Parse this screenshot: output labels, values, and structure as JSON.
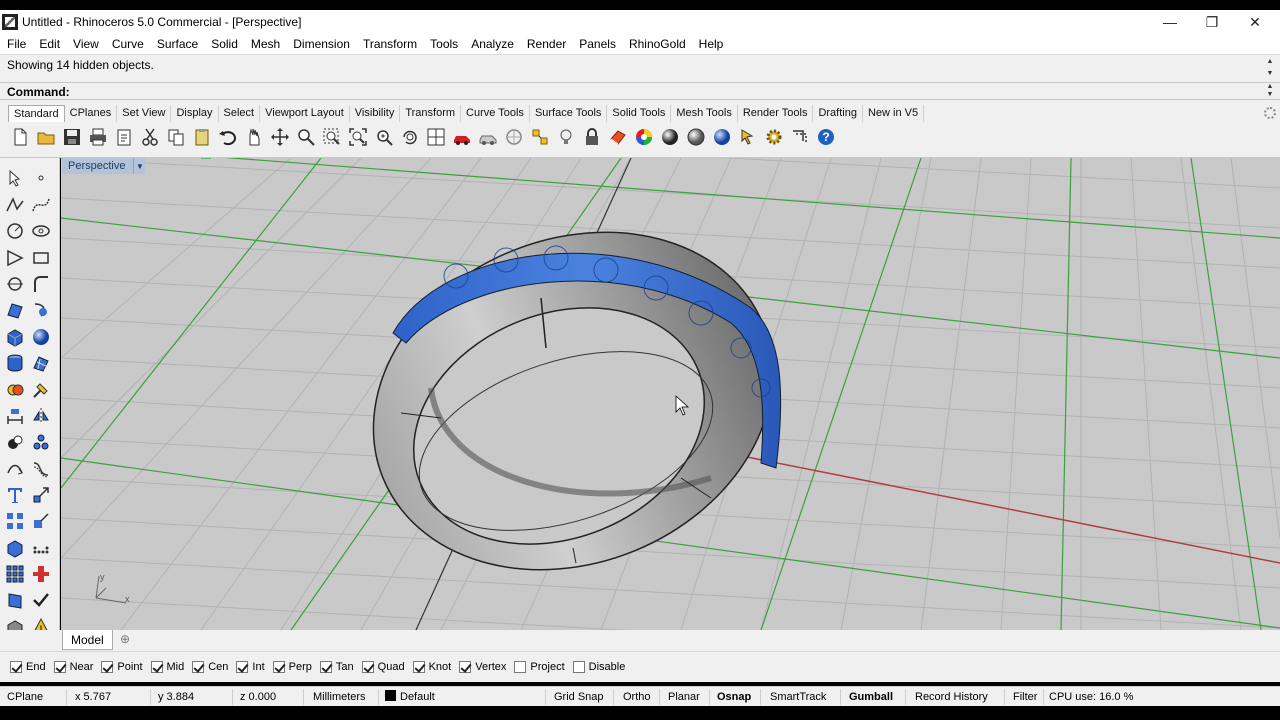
{
  "window": {
    "title": "Untitled - Rhinoceros 5.0 Commercial - [Perspective]",
    "controls": {
      "minimize": "—",
      "restore": "❐",
      "close": "✕"
    }
  },
  "menu": [
    "File",
    "Edit",
    "View",
    "Curve",
    "Surface",
    "Solid",
    "Mesh",
    "Dimension",
    "Transform",
    "Tools",
    "Analyze",
    "Render",
    "Panels",
    "RhinoGold",
    "Help"
  ],
  "command_history": "Showing 14 hidden objects.",
  "command_prompt": "Command:",
  "toolbar_tabs": [
    "Standard",
    "CPlanes",
    "Set View",
    "Display",
    "Select",
    "Viewport Layout",
    "Visibility",
    "Transform",
    "Curve Tools",
    "Surface Tools",
    "Solid Tools",
    "Mesh Tools",
    "Render Tools",
    "Drafting",
    "New in V5"
  ],
  "toolbar_active_tab": "Standard",
  "toolbar_icons": [
    "new-file-icon",
    "open-file-icon",
    "save-icon",
    "print-icon",
    "import-icon",
    "cut-icon",
    "copy-icon",
    "paste-icon",
    "undo-icon",
    "pan-icon",
    "rotate-view-icon",
    "zoom-icon",
    "zoom-window-icon",
    "zoom-extents-icon",
    "zoom-selected-icon",
    "zoom-dynamic-icon",
    "four-viewports-icon",
    "car-icon",
    "light-car-icon",
    "circle-icon",
    "snap-icon",
    "lightbulb-icon",
    "lock-icon",
    "layer-icon",
    "color-wheel-icon",
    "shade-sphere-icon",
    "rendered-sphere-icon",
    "blue-sphere-icon",
    "select-icon",
    "options-gear-icon",
    "trim-icon",
    "help-icon"
  ],
  "viewport": {
    "label": "Perspective",
    "axis_label_y": "y",
    "axis_label_x": "x"
  },
  "model_tab": "Model",
  "model_tab_add": "⊕",
  "osnaps": [
    {
      "label": "End",
      "checked": true
    },
    {
      "label": "Near",
      "checked": true
    },
    {
      "label": "Point",
      "checked": true
    },
    {
      "label": "Mid",
      "checked": true
    },
    {
      "label": "Cen",
      "checked": true
    },
    {
      "label": "Int",
      "checked": true
    },
    {
      "label": "Perp",
      "checked": true
    },
    {
      "label": "Tan",
      "checked": true
    },
    {
      "label": "Quad",
      "checked": true
    },
    {
      "label": "Knot",
      "checked": true
    },
    {
      "label": "Vertex",
      "checked": true
    },
    {
      "label": "Project",
      "checked": false
    },
    {
      "label": "Disable",
      "checked": false
    }
  ],
  "status": {
    "cplane": "CPlane",
    "x": "x 5.767",
    "y": "y 3.884",
    "z": "z 0.000",
    "units": "Millimeters",
    "layer": "Default",
    "grid_snap": "Grid Snap",
    "ortho": "Ortho",
    "planar": "Planar",
    "osnap": "Osnap",
    "smarttrack": "SmartTrack",
    "gumball": "Gumball",
    "record_history": "Record History",
    "filter": "Filter",
    "cpu": "CPU use: 16.0 %"
  },
  "colors": {
    "accent_blue": "#3a6fd8",
    "grid_green": "#3ca03c",
    "x_axis_red": "#b04040",
    "viewport_bg": "#c9c9c9"
  }
}
